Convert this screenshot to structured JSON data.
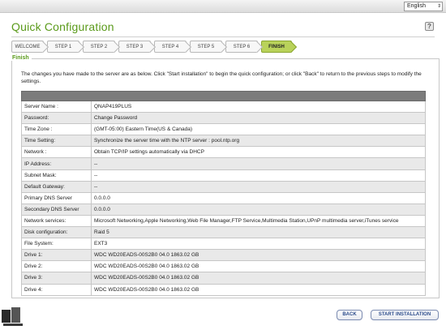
{
  "topbar": {
    "language": "English"
  },
  "page": {
    "title": "Quick Configuration"
  },
  "steps": [
    "WELCOME",
    "STEP 1",
    "STEP 2",
    "STEP 3",
    "STEP 4",
    "STEP 5",
    "STEP 6",
    "FINISH"
  ],
  "active_step": "FINISH",
  "panel": {
    "legend": "Finish",
    "intro": "The changes you have made to the server are as below. Click \"Start installation\" to begin the quick configuration; or click \"Back\" to return to the previous steps to modify the settings."
  },
  "summary": [
    {
      "label": "Server Name :",
      "value": "QNAP419PLUS"
    },
    {
      "label": "Password:",
      "value": "Change Password"
    },
    {
      "label": "Time Zone :",
      "value": "(GMT-05:00) Eastern Time(US & Canada)"
    },
    {
      "label": "Time Setting:",
      "value": "Synchronize the server time with the NTP server : pool.ntp.org"
    },
    {
      "label": "Network :",
      "value": "Obtain TCP/IP settings automatically via DHCP"
    },
    {
      "label": "IP Address:",
      "value": "--"
    },
    {
      "label": "Subnet Mask:",
      "value": "--"
    },
    {
      "label": "Default Gateway:",
      "value": "--"
    },
    {
      "label": "Primary DNS Server",
      "value": "0.0.0.0"
    },
    {
      "label": "Secondary DNS Server",
      "value": "0.0.0.0"
    },
    {
      "label": "Network services:",
      "value": "Microsoft Networking,Apple Networking,Web File Manager,FTP Service,Multimedia Station,UPnP multimedia server,iTunes service"
    },
    {
      "label": "Disk configuration:",
      "value": "Raid 5"
    },
    {
      "label": "File System:",
      "value": "EXT3"
    },
    {
      "label": "Drive 1:",
      "value": "WDC WD20EADS-00S2B0 04.0 1863.02 GB"
    },
    {
      "label": "Drive 2:",
      "value": "WDC WD20EADS-00S2B0 04.0 1863.02 GB"
    },
    {
      "label": "Drive 3:",
      "value": "WDC WD20EADS-00S2B0 04.0 1863.02 GB"
    },
    {
      "label": "Drive 4:",
      "value": "WDC WD20EADS-00S2B0 04.0 1863.02 GB"
    }
  ],
  "buttons": {
    "back": "BACK",
    "start": "START INSTALLATION"
  },
  "colors": {
    "accent": "#5a9a1a",
    "active_step": "#b9d25a",
    "header_row": "#7c7c7c",
    "button_text": "#2a4a8a"
  }
}
